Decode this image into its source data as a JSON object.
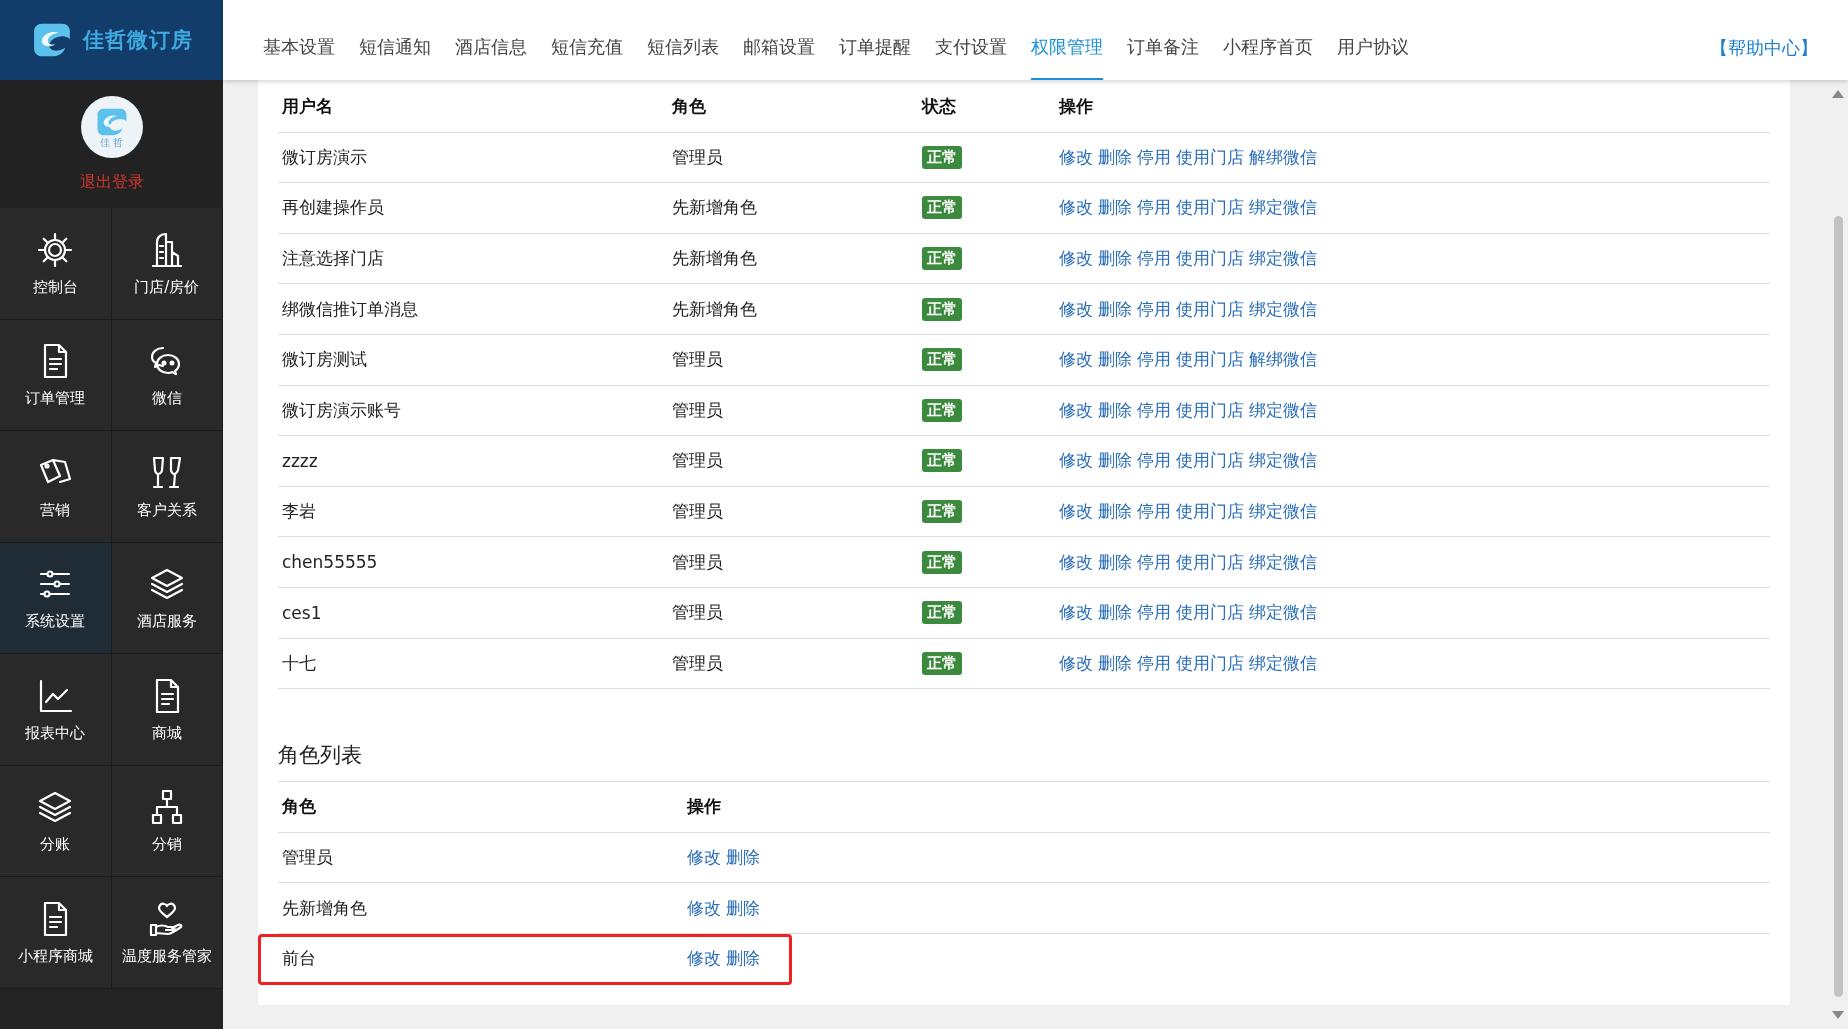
{
  "brand": {
    "name": "佳哲微订房"
  },
  "profile": {
    "avatar_caption": "佳 哲",
    "logout": "退出登录"
  },
  "sidebar": {
    "items": [
      {
        "label": "控制台",
        "selected": false
      },
      {
        "label": "门店/房价",
        "selected": false
      },
      {
        "label": "订单管理",
        "selected": false
      },
      {
        "label": "微信",
        "selected": false
      },
      {
        "label": "营销",
        "selected": false
      },
      {
        "label": "客户关系",
        "selected": false
      },
      {
        "label": "系统设置",
        "selected": true
      },
      {
        "label": "酒店服务",
        "selected": false
      },
      {
        "label": "报表中心",
        "selected": false
      },
      {
        "label": "商城",
        "selected": false
      },
      {
        "label": "分账",
        "selected": false
      },
      {
        "label": "分销",
        "selected": false
      },
      {
        "label": "小程序商城",
        "selected": false
      },
      {
        "label": "温度服务管家",
        "selected": false
      }
    ]
  },
  "nav": {
    "tabs": [
      {
        "label": "基本设置",
        "selected": false
      },
      {
        "label": "短信通知",
        "selected": false
      },
      {
        "label": "酒店信息",
        "selected": false
      },
      {
        "label": "短信充值",
        "selected": false
      },
      {
        "label": "短信列表",
        "selected": false
      },
      {
        "label": "邮箱设置",
        "selected": false
      },
      {
        "label": "订单提醒",
        "selected": false
      },
      {
        "label": "支付设置",
        "selected": false
      },
      {
        "label": "权限管理",
        "selected": true
      },
      {
        "label": "订单备注",
        "selected": false
      },
      {
        "label": "小程序首页",
        "selected": false
      },
      {
        "label": "用户协议",
        "selected": false
      }
    ],
    "help": "【帮助中心】"
  },
  "users": {
    "columns": [
      "用户名",
      "角色",
      "状态",
      "操作"
    ],
    "rows": [
      {
        "name": "微订房演示",
        "role": "管理员",
        "status": "正常",
        "actions": [
          "修改",
          "删除",
          "停用",
          "使用门店",
          "解绑微信"
        ]
      },
      {
        "name": "再创建操作员",
        "role": "先新增角色",
        "status": "正常",
        "actions": [
          "修改",
          "删除",
          "停用",
          "使用门店",
          "绑定微信"
        ]
      },
      {
        "name": "注意选择门店",
        "role": "先新增角色",
        "status": "正常",
        "actions": [
          "修改",
          "删除",
          "停用",
          "使用门店",
          "绑定微信"
        ]
      },
      {
        "name": "绑微信推订单消息",
        "role": "先新增角色",
        "status": "正常",
        "actions": [
          "修改",
          "删除",
          "停用",
          "使用门店",
          "绑定微信"
        ]
      },
      {
        "name": "微订房测试",
        "role": "管理员",
        "status": "正常",
        "actions": [
          "修改",
          "删除",
          "停用",
          "使用门店",
          "解绑微信"
        ]
      },
      {
        "name": "微订房演示账号",
        "role": "管理员",
        "status": "正常",
        "actions": [
          "修改",
          "删除",
          "停用",
          "使用门店",
          "绑定微信"
        ]
      },
      {
        "name": "zzzz",
        "role": "管理员",
        "status": "正常",
        "actions": [
          "修改",
          "删除",
          "停用",
          "使用门店",
          "绑定微信"
        ]
      },
      {
        "name": "李岩",
        "role": "管理员",
        "status": "正常",
        "actions": [
          "修改",
          "删除",
          "停用",
          "使用门店",
          "绑定微信"
        ]
      },
      {
        "name": "chen55555",
        "role": "管理员",
        "status": "正常",
        "actions": [
          "修改",
          "删除",
          "停用",
          "使用门店",
          "绑定微信"
        ]
      },
      {
        "name": "ces1",
        "role": "管理员",
        "status": "正常",
        "actions": [
          "修改",
          "删除",
          "停用",
          "使用门店",
          "绑定微信"
        ]
      },
      {
        "name": "十七",
        "role": "管理员",
        "status": "正常",
        "actions": [
          "修改",
          "删除",
          "停用",
          "使用门店",
          "绑定微信"
        ]
      }
    ]
  },
  "roles": {
    "title": "角色列表",
    "columns": [
      "角色",
      "操作"
    ],
    "rows": [
      {
        "role": "管理员",
        "actions": [
          "修改",
          "删除"
        ],
        "highlighted": false
      },
      {
        "role": "先新增角色",
        "actions": [
          "修改",
          "删除"
        ],
        "highlighted": false
      },
      {
        "role": "前台",
        "actions": [
          "修改",
          "删除"
        ],
        "highlighted": true
      }
    ]
  }
}
